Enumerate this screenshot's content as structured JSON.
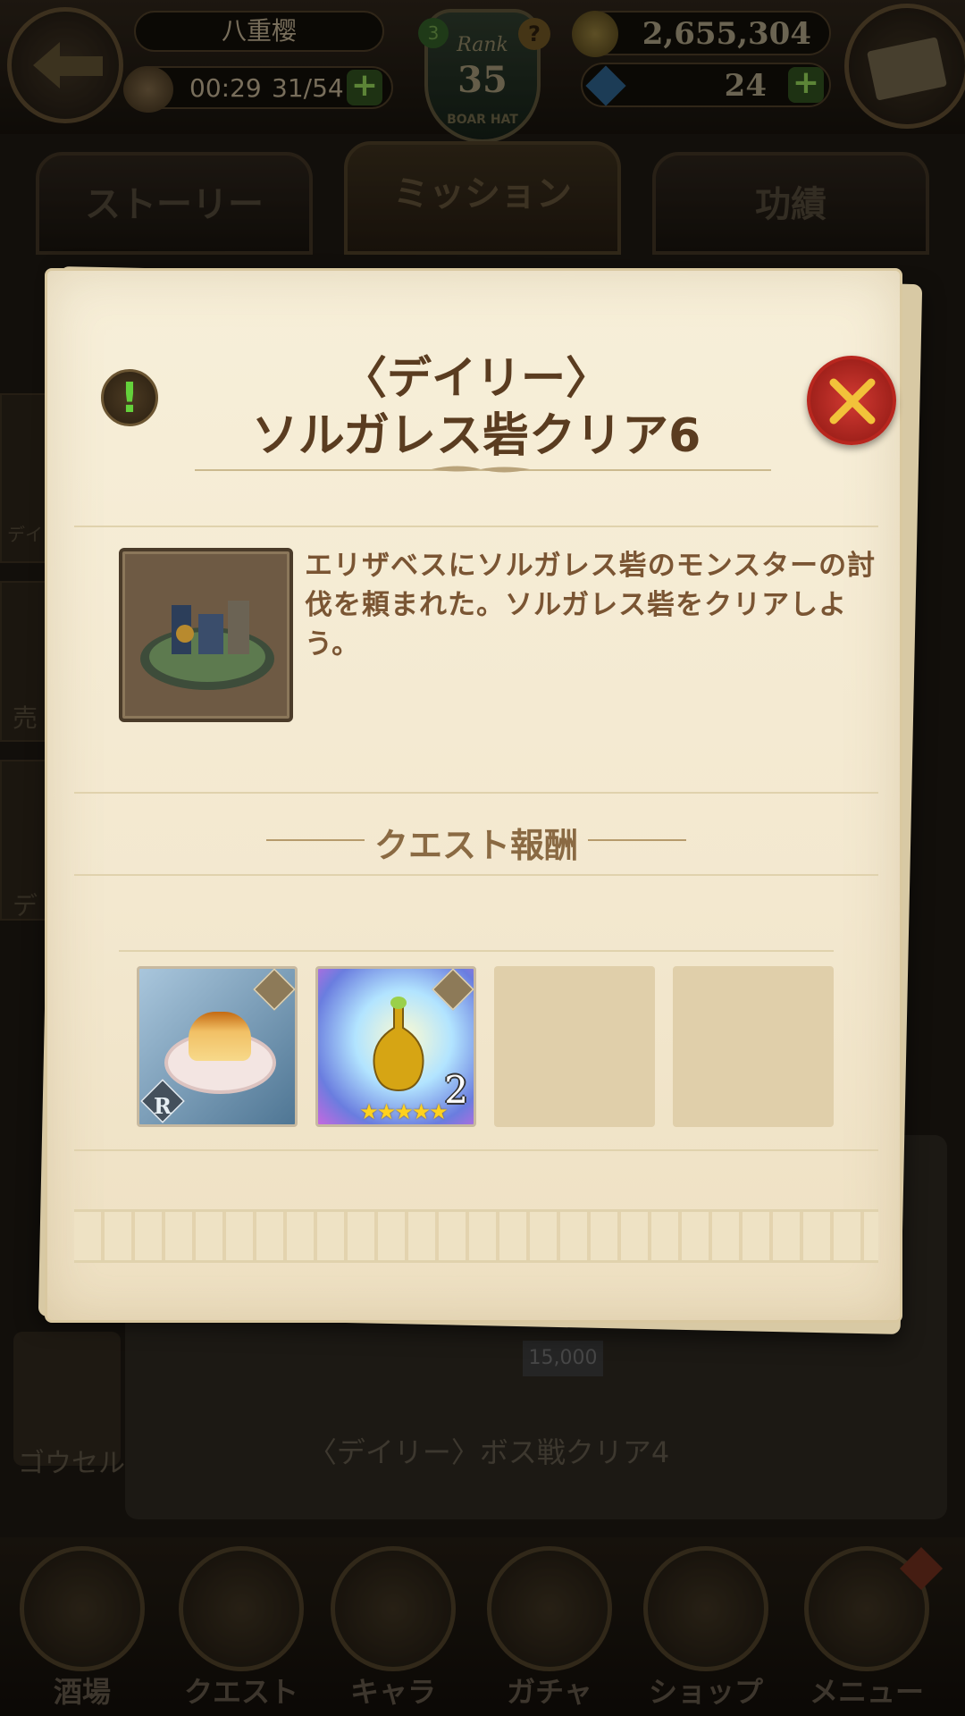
{
  "header": {
    "player_name": "八重樱",
    "stamina_timer": "00:29",
    "stamina": "31/54",
    "rank_label": "Rank",
    "rank": "35",
    "rank_sub": "BOAR HAT",
    "rank_badge_b": "3",
    "rank_help": "?",
    "gold": "2,655,304",
    "gems": "24"
  },
  "tabs": [
    {
      "label": "ストーリー"
    },
    {
      "label": "ミッション"
    },
    {
      "label": "功績"
    }
  ],
  "background": {
    "mission_title": "〈デイリー〉ボス戦クリア4",
    "reward_amount": "15,000",
    "avatar_name": "ゴウセル",
    "side_labels": [
      "デイリ",
      "売",
      "デ"
    ]
  },
  "dialog": {
    "title_line1": "〈デイリー〉",
    "title_line2": "ソルガレス砦クリア6",
    "description": "エリザベスにソルガレス砦のモンスターの討伐を頼まれた。ソルガレス砦をクリアしよう。",
    "reward_heading": "クエスト報酬",
    "rewards": [
      {
        "icon": "pudding-icon",
        "rarity": "R"
      },
      {
        "icon": "elixir-bottle-icon",
        "quantity": "2",
        "stars": "★★★★★"
      }
    ]
  },
  "bottom_nav": [
    {
      "label": "酒場",
      "icon": "tavern-icon"
    },
    {
      "label": "クエスト",
      "icon": "scroll-icon"
    },
    {
      "label": "キャラ",
      "icon": "helmet-icon"
    },
    {
      "label": "ガチャ",
      "icon": "crystal-icon"
    },
    {
      "label": "ショップ",
      "icon": "shop-icon"
    },
    {
      "label": "メニュー",
      "icon": "gear-icon"
    }
  ],
  "colors": {
    "title": "#5a3c20",
    "description": "#7a5533",
    "close_button": "#c92a22",
    "info_icon": "#64d13b"
  }
}
